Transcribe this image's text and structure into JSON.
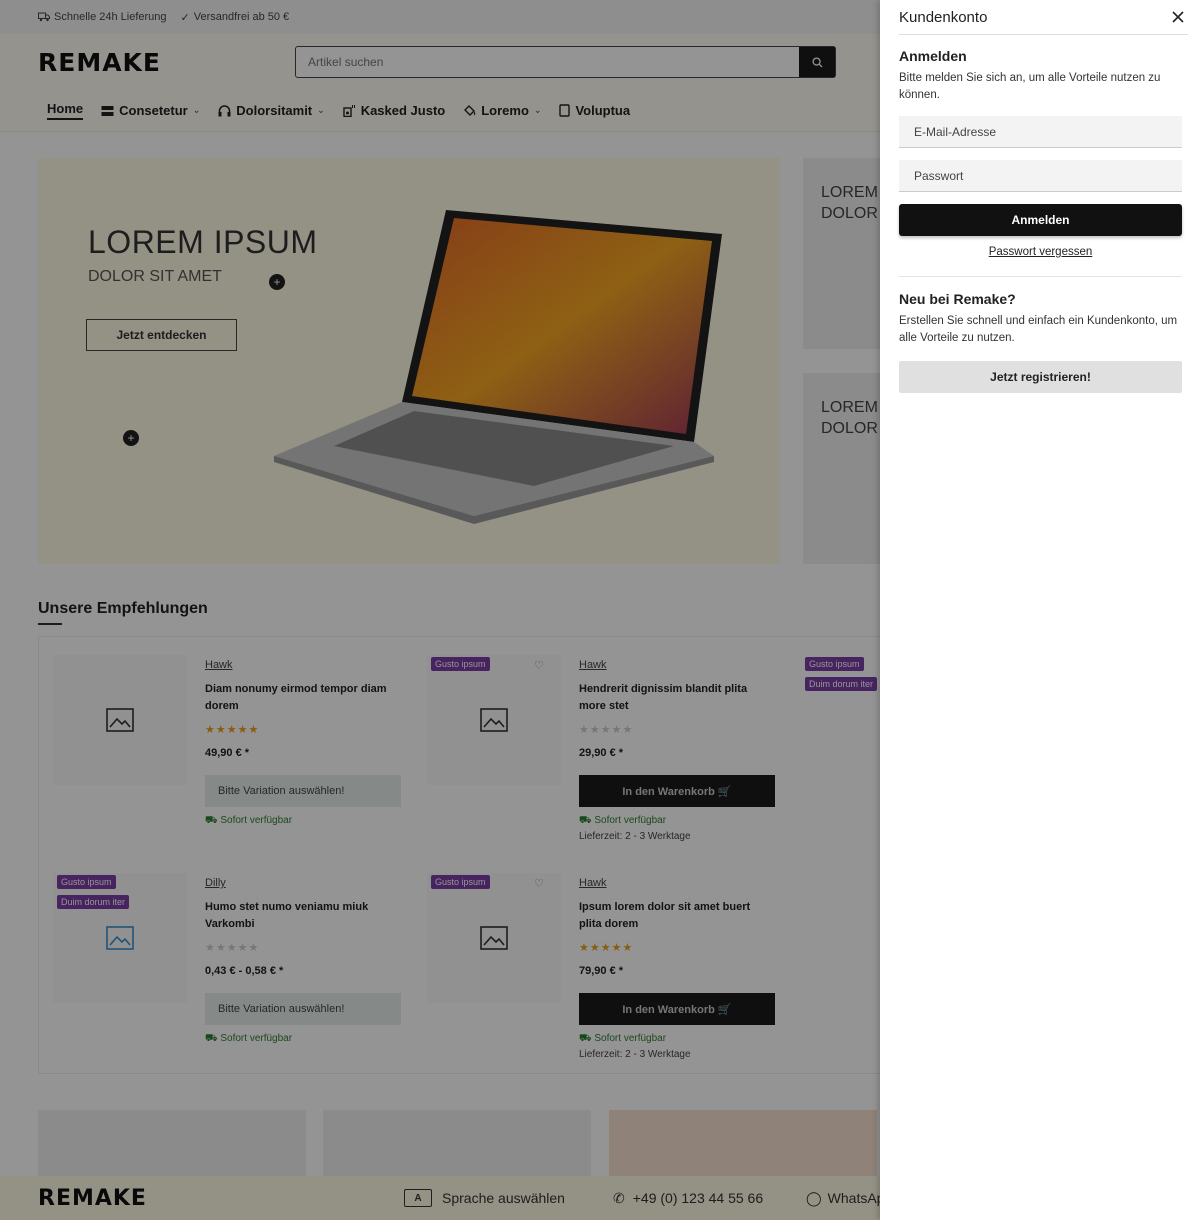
{
  "topbar": {
    "delivery": "Schnelle 24h Lieferung",
    "shipping": "Versandfrei ab 50 €"
  },
  "header": {
    "logo": "REMAKE",
    "search_placeholder": "Artikel suchen"
  },
  "nav": {
    "items": [
      {
        "label": "Home"
      },
      {
        "label": "Consetetur"
      },
      {
        "label": "Dolorsitamit"
      },
      {
        "label": "Kasked Justo"
      },
      {
        "label": "Loremo"
      },
      {
        "label": "Voluptua"
      }
    ]
  },
  "hero": {
    "title": "LOREM IPSUM",
    "subtitle": "DOLOR SIT AMET",
    "cta": "Jetzt entdecken",
    "side_cards": [
      {
        "line1": "LOREM",
        "line2": "DOLOR"
      },
      {
        "line1": "LOREM",
        "line2": "DOLOR"
      }
    ]
  },
  "recommendations": {
    "title": "Unsere Empfehlungen",
    "products": [
      {
        "brand": "Hawk",
        "name": "Diam nonumy eirmod tempor diam dorem",
        "rating": 5,
        "price": "49,90 € *",
        "button": "Bitte Variation auswählen!",
        "availability": "Sofort verfügbar",
        "delivery_time": ""
      },
      {
        "brand": "Hawk",
        "name": "Hendrerit dignissim blandit plita more stet",
        "rating": 0,
        "price": "29,90 € *",
        "button": "In den Warenkorb",
        "availability": "Sofort verfügbar",
        "delivery_time": "Lieferzeit: 2 - 3 Werktage",
        "badges": [
          "Gusto ipsum"
        ]
      },
      {
        "brand": "Dilly",
        "name": "Humo stet numo veniamu miuk Varkombi",
        "rating": 0,
        "price": "0,43 € - 0,58 € *",
        "button": "Bitte Variation auswählen!",
        "availability": "Sofort verfügbar",
        "delivery_time": "",
        "badges": [
          "Gusto ipsum",
          "Duim dorum iter"
        ]
      },
      {
        "brand": "Hawk",
        "name": "Ipsum lorem dolor sit amet buert plita dorem",
        "rating": 5,
        "price": "79,90 € *",
        "button": "In den Warenkorb",
        "availability": "Sofort verfügbar",
        "delivery_time": "Lieferzeit: 2 - 3 Werktage",
        "badges": [
          "Gusto ipsum"
        ]
      }
    ],
    "partial_badges": [
      "Gusto ipsum",
      "Duim dorum iter"
    ]
  },
  "footer": {
    "logo": "REMAKE",
    "language": "Sprache auswählen",
    "phone": "+49 (0) 123 44 55 66",
    "whatsapp": "WhatsAp"
  },
  "drawer": {
    "title": "Kundenkonto",
    "login": {
      "heading": "Anmelden",
      "text": "Bitte melden Sie sich an, um alle Vorteile nutzen zu können.",
      "email_placeholder": "E-Mail-Adresse",
      "password_placeholder": "Passwort",
      "button": "Anmelden",
      "forgot": "Passwort vergessen"
    },
    "register": {
      "heading": "Neu bei Remake?",
      "text": "Erstellen Sie schnell und einfach ein Kundenkonto, um alle Vorteile zu nutzen.",
      "button": "Jetzt registrieren!"
    }
  },
  "colors": {
    "accent_dark": "#111111",
    "badge_purple": "#7b3fa6",
    "availability_green": "#2e7d32",
    "star_orange": "#e8a020"
  }
}
